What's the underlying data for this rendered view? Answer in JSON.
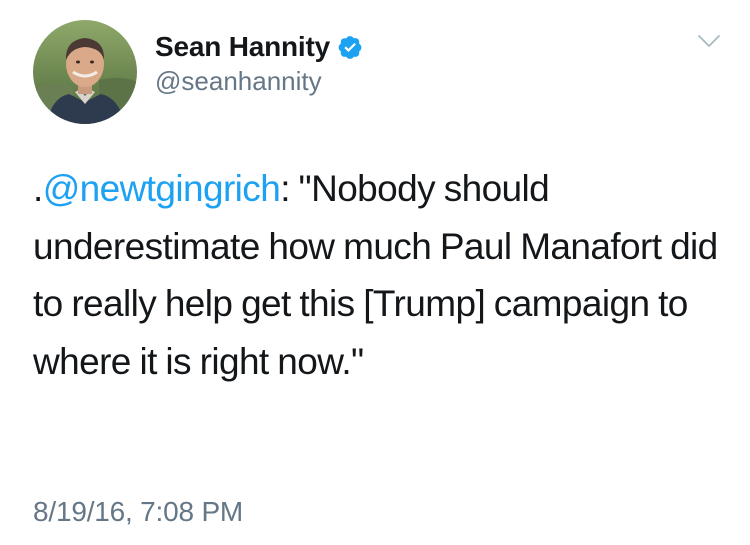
{
  "user": {
    "display_name": "Sean Hannity",
    "handle": "@seanhannity",
    "verified": true,
    "verified_color": "#1da1f2"
  },
  "icons": {
    "verified": "verified-badge-icon",
    "menu": "chevron-down-icon"
  },
  "tweet": {
    "prefix": ".",
    "mention": "@newtgingrich",
    "body": ": \"Nobody should underestimate how much Paul Manafort did to really help get this [Trump] campaign to where it is right now.\"",
    "timestamp": "8/19/16, 7:08 PM"
  },
  "colors": {
    "link": "#1da1f2",
    "text": "#14171a",
    "secondary": "#657786"
  }
}
